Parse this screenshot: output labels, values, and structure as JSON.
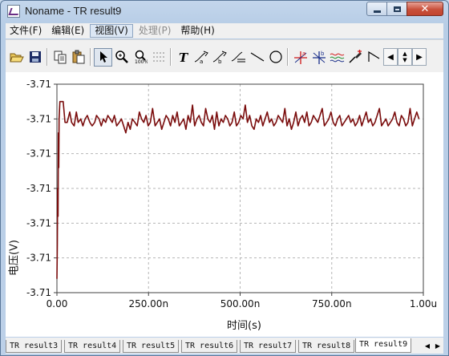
{
  "window": {
    "title": "Noname - TR result9",
    "minimize_label": "",
    "maximize_label": "",
    "close_label": "✕"
  },
  "menu": [
    {
      "label": "文件(F)",
      "state": "normal"
    },
    {
      "label": "编辑(E)",
      "state": "normal"
    },
    {
      "label": "视图(V)",
      "state": "active"
    },
    {
      "label": "处理(P)",
      "state": "disabled"
    },
    {
      "label": "帮助(H)",
      "state": "normal"
    }
  ],
  "toolbar": {
    "icons": [
      "open-folder-icon",
      "save-disk-icon",
      "copy-icon",
      "paste-icon",
      "pointer-arrow-icon",
      "zoom-in-icon",
      "zoom-100-icon",
      "grid-dots-icon",
      "text-tool-icon",
      "cursor-a-icon",
      "cursor-b-icon",
      "marker-line-icon",
      "line-tool-icon",
      "circle-tool-icon",
      "cross-marker-a-icon",
      "cross-marker-b-icon",
      "wave-icon",
      "pen-marker-icon",
      "angle-tool-icon"
    ],
    "scroll_left": "◀",
    "scroll_updown": "▲▼",
    "scroll_right": "▶"
  },
  "chart_data": {
    "type": "line",
    "xlabel": "时间(s)",
    "ylabel": "电压(V)",
    "x_ticks": [
      "0.00",
      "250.00n",
      "500.00n",
      "750.00n",
      "1.00u"
    ],
    "y_ticks": [
      "-3.71",
      "-3.71",
      "-3.71",
      "-3.71",
      "-3.71",
      "-3.71",
      "-3.71"
    ],
    "xlim_ns": [
      0,
      1000
    ],
    "grid": true,
    "line_color": "#7a0c0c",
    "series_norm": {
      "note_units": "y in units of one tick step above the bottom axis (bottom = 0, top = 6)",
      "x_ns": [
        0,
        1,
        2,
        3,
        4,
        5,
        6,
        8,
        12,
        17,
        22,
        28,
        35,
        40,
        47,
        53,
        58,
        65,
        71,
        77,
        83,
        90,
        96,
        103,
        108,
        115,
        121,
        127,
        133,
        139,
        145,
        151,
        157,
        163,
        170,
        176,
        182,
        188,
        194,
        200,
        206,
        213,
        219,
        225,
        231,
        237,
        243,
        249,
        255,
        261,
        268,
        274,
        280,
        286,
        292,
        298,
        304,
        310,
        316,
        322,
        328,
        334,
        340,
        346,
        352,
        358,
        364,
        370,
        376,
        382,
        388,
        394,
        400,
        406,
        412,
        418,
        424,
        430,
        436,
        442,
        448,
        454,
        460,
        466,
        472,
        478,
        484,
        490,
        496,
        502,
        508,
        514,
        520,
        526,
        532,
        538,
        544,
        550,
        556,
        562,
        568,
        574,
        580,
        586,
        592,
        598,
        604,
        610,
        616,
        622,
        628,
        634,
        640,
        646,
        652,
        658,
        664,
        670,
        676,
        682,
        688,
        694,
        700,
        706,
        712,
        718,
        724,
        730,
        736,
        742,
        748,
        754,
        760,
        766,
        772,
        778,
        784,
        790,
        796,
        802,
        808,
        814,
        820,
        826,
        832,
        838,
        844,
        850,
        856,
        862,
        868,
        874,
        880,
        886,
        892,
        898,
        904,
        910,
        916,
        922,
        928,
        934,
        940,
        946,
        952,
        958,
        964,
        970,
        976,
        982,
        988,
        994,
        1000
      ],
      "y": [
        0.4,
        1.4,
        3.0,
        2.2,
        4.6,
        3.6,
        5.0,
        5.5,
        5.5,
        5.5,
        4.9,
        4.9,
        5.2,
        4.9,
        4.8,
        5.2,
        4.9,
        5.0,
        4.8,
        5.0,
        5.1,
        4.9,
        4.8,
        4.9,
        5.1,
        5.0,
        4.8,
        5.0,
        4.9,
        5.1,
        5.0,
        4.9,
        5.1,
        4.8,
        4.9,
        5.0,
        4.8,
        4.6,
        4.9,
        4.7,
        5.0,
        4.9,
        4.8,
        5.2,
        5.0,
        4.9,
        5.1,
        4.8,
        4.9,
        5.3,
        4.8,
        4.9,
        5.0,
        4.7,
        4.9,
        5.1,
        5.0,
        4.8,
        5.1,
        4.9,
        5.2,
        4.8,
        4.9,
        5.0,
        4.7,
        5.1,
        4.9,
        5.4,
        4.8,
        5.0,
        5.1,
        4.9,
        4.8,
        5.3,
        5.0,
        4.9,
        5.1,
        4.7,
        5.2,
        4.8,
        5.0,
        4.9,
        5.1,
        5.0,
        4.8,
        4.9,
        5.2,
        4.8,
        4.9,
        5.1,
        5.0,
        5.4,
        4.9,
        5.1,
        4.8,
        4.7,
        5.0,
        4.9,
        5.1,
        4.8,
        5.0,
        5.2,
        4.9,
        5.0,
        4.8,
        4.9,
        5.1,
        5.0,
        4.9,
        5.3,
        4.8,
        5.0,
        4.7,
        4.9,
        5.2,
        4.8,
        5.0,
        5.1,
        4.9,
        5.2,
        4.8,
        4.9,
        5.1,
        5.0,
        4.9,
        5.1,
        5.3,
        4.8,
        4.9,
        5.0,
        5.2,
        4.9,
        4.8,
        5.0,
        5.1,
        4.8,
        4.9,
        5.0,
        5.1,
        4.9,
        5.0,
        4.8,
        4.9,
        5.1,
        4.8,
        5.0,
        5.2,
        4.9,
        5.0,
        4.8,
        4.9,
        5.1,
        5.3,
        4.8,
        4.9,
        5.0,
        4.8,
        4.9,
        5.0,
        5.2,
        4.9,
        4.8,
        5.1,
        5.0,
        4.8,
        4.9,
        5.3,
        4.8,
        5.0,
        5.2,
        5.0
      ]
    }
  },
  "tabs": [
    {
      "label": "TR result3",
      "active": false
    },
    {
      "label": "TR result4",
      "active": false
    },
    {
      "label": "TR result5",
      "active": false
    },
    {
      "label": "TR result6",
      "active": false
    },
    {
      "label": "TR result7",
      "active": false
    },
    {
      "label": "TR result8",
      "active": false
    },
    {
      "label": "TR result9",
      "active": true
    }
  ],
  "tab_nav": {
    "prev": "◀",
    "next": "▶"
  }
}
